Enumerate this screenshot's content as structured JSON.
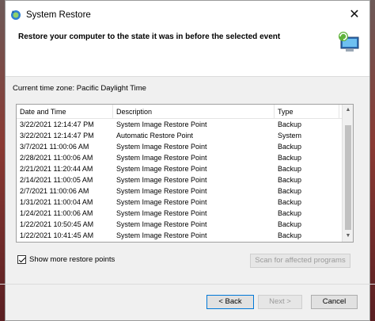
{
  "window": {
    "title": "System Restore",
    "heading": "Restore your computer to the state it was in before the selected event",
    "close_glyph": "✕"
  },
  "timezone": "Current time zone: Pacific Daylight Time",
  "table": {
    "columns": [
      "Date and Time",
      "Description",
      "Type"
    ],
    "rows": [
      [
        "3/22/2021 12:14:47 PM",
        "System Image Restore Point",
        "Backup"
      ],
      [
        "3/22/2021 12:14:47 PM",
        "Automatic Restore Point",
        "System"
      ],
      [
        "3/7/2021 11:00:06 AM",
        "System Image Restore Point",
        "Backup"
      ],
      [
        "2/28/2021 11:00:06 AM",
        "System Image Restore Point",
        "Backup"
      ],
      [
        "2/21/2021 11:20:44 AM",
        "System Image Restore Point",
        "Backup"
      ],
      [
        "2/14/2021 11:00:05 AM",
        "System Image Restore Point",
        "Backup"
      ],
      [
        "2/7/2021 11:00:06 AM",
        "System Image Restore Point",
        "Backup"
      ],
      [
        "1/31/2021 11:00:04 AM",
        "System Image Restore Point",
        "Backup"
      ],
      [
        "1/24/2021 11:00:06 AM",
        "System Image Restore Point",
        "Backup"
      ],
      [
        "1/22/2021 10:50:45 AM",
        "System Image Restore Point",
        "Backup"
      ],
      [
        "1/22/2021 10:41:45 AM",
        "System Image Restore Point",
        "Backup"
      ]
    ]
  },
  "show_more": {
    "label": "Show more restore points",
    "checked": true
  },
  "buttons": {
    "scan": "Scan for affected programs",
    "back": "< Back",
    "next": "Next >",
    "cancel": "Cancel"
  }
}
